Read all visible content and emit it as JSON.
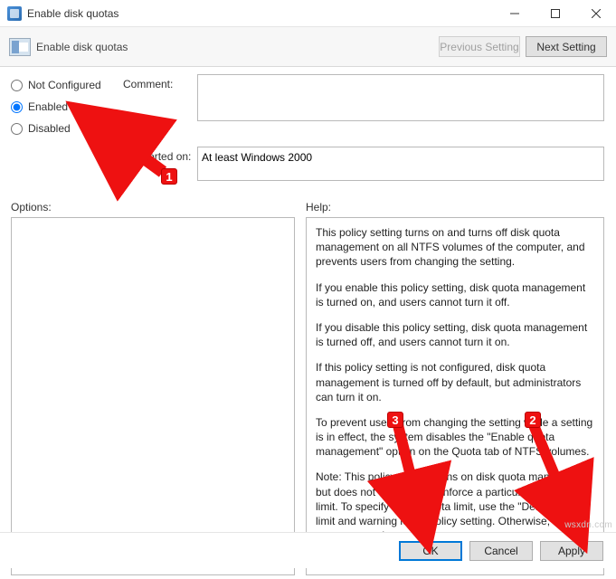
{
  "window": {
    "title": "Enable disk quotas"
  },
  "header": {
    "title": "Enable disk quotas",
    "prev": "Previous Setting",
    "next": "Next Setting"
  },
  "radios": {
    "not_configured": "Not Configured",
    "enabled": "Enabled",
    "disabled": "Disabled",
    "selected": "enabled"
  },
  "labels": {
    "comment": "Comment:",
    "supported": "Supported on:",
    "options": "Options:",
    "help": "Help:"
  },
  "fields": {
    "comment": "",
    "supported": "At least Windows 2000"
  },
  "help": {
    "p1": "This policy setting turns on and turns off disk quota management on all NTFS volumes of the computer, and prevents users from changing the setting.",
    "p2": "If you enable this policy setting, disk quota management is turned on, and users cannot turn it off.",
    "p3": "If you disable this policy setting, disk quota management is turned off, and users cannot turn it on.",
    "p4": "If this policy setting is not configured, disk quota management is turned off by default, but administrators can turn it on.",
    "p5": "To prevent users from changing the setting while a setting is in effect, the system disables the \"Enable quota management\" option on the Quota tab of NTFS volumes.",
    "p6": "Note: This policy setting turns on disk quota management but does not establish or enforce a particular disk quota limit. To specify a disk quota limit, use the \"Default quota limit and warning level\" policy setting. Otherwise, the system uses the"
  },
  "footer": {
    "ok": "OK",
    "cancel": "Cancel",
    "apply": "Apply"
  },
  "annotations": {
    "a1": "1",
    "a2": "2",
    "a3": "3"
  },
  "watermark": "wsxdn.com"
}
